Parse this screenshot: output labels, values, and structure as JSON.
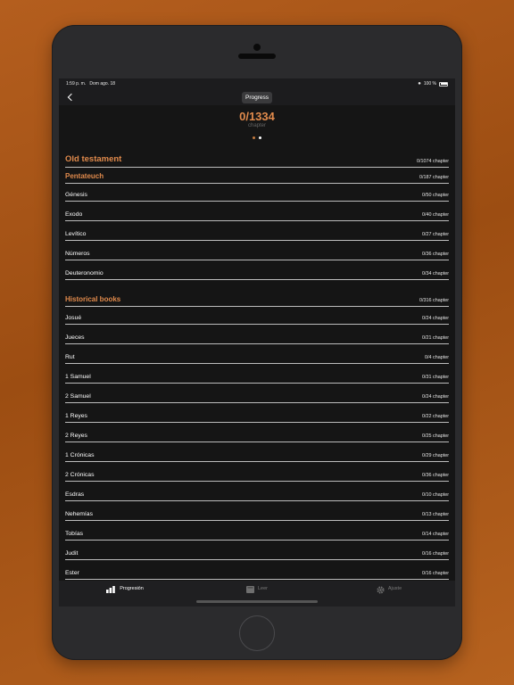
{
  "status_bar": {
    "time": "1:59 p. m.",
    "date": "Dom ago. 18",
    "battery": "100 %"
  },
  "nav": {
    "title": "Progress"
  },
  "summary": {
    "total": "0/1334",
    "label": "chapter"
  },
  "rows": [
    {
      "type": "testament",
      "name": "Old testament",
      "count": "0/1074 chapter"
    },
    {
      "type": "category",
      "name": "Pentateuch",
      "count": "0/187 chapter"
    },
    {
      "type": "book",
      "name": "Génesis",
      "count": "0/50 chapter"
    },
    {
      "type": "book",
      "name": "Exodo",
      "count": "0/40 chapter"
    },
    {
      "type": "book",
      "name": "Levítico",
      "count": "0/27 chapter"
    },
    {
      "type": "book",
      "name": "Números",
      "count": "0/36 chapter"
    },
    {
      "type": "book",
      "name": "Deuteronomio",
      "count": "0/34 chapter"
    },
    {
      "type": "category",
      "name": "Historical books",
      "count": "0/316 chapter"
    },
    {
      "type": "book",
      "name": "Josué",
      "count": "0/24 chapter"
    },
    {
      "type": "book",
      "name": "Jueces",
      "count": "0/21 chapter"
    },
    {
      "type": "book",
      "name": "Rut",
      "count": "0/4 chapter"
    },
    {
      "type": "book",
      "name": "1 Samuel",
      "count": "0/31 chapter"
    },
    {
      "type": "book",
      "name": "2 Samuel",
      "count": "0/24 chapter"
    },
    {
      "type": "book",
      "name": "1 Reyes",
      "count": "0/22 chapter"
    },
    {
      "type": "book",
      "name": "2 Reyes",
      "count": "0/25 chapter"
    },
    {
      "type": "book",
      "name": "1 Crónicas",
      "count": "0/29 chapter"
    },
    {
      "type": "book",
      "name": "2 Crónicas",
      "count": "0/36 chapter"
    },
    {
      "type": "book",
      "name": "Esdras",
      "count": "0/10 chapter"
    },
    {
      "type": "book",
      "name": "Nehemías",
      "count": "0/13 chapter"
    },
    {
      "type": "book",
      "name": "Tobías",
      "count": "0/14 chapter"
    },
    {
      "type": "book",
      "name": "Judit",
      "count": "0/16 chapter"
    },
    {
      "type": "book",
      "name": "Ester",
      "count": "0/16 chapter"
    }
  ],
  "tabs": [
    {
      "label": "Progresión",
      "icon": "chart-icon",
      "active": true
    },
    {
      "label": "Leer",
      "icon": "book-icon",
      "active": false
    },
    {
      "label": "Ajuste",
      "icon": "gear-icon",
      "active": false
    }
  ],
  "colors": {
    "accent": "#e08a4c",
    "background": "#151515"
  }
}
